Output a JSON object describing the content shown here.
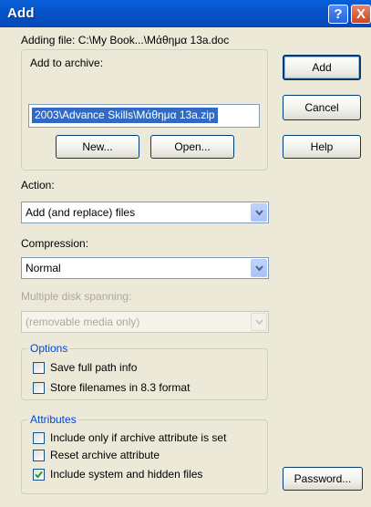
{
  "window": {
    "title": "Add",
    "help_glyph": "?",
    "close_glyph": "X"
  },
  "adding_file": "Adding file: C:\\My Book...\\Μάθημα 13a.doc",
  "add_to_archive": {
    "label": "Add to archive:",
    "value": "2003\\Advance Skills\\Μάθημα 13a.zip",
    "new_label": "New...",
    "open_label": "Open..."
  },
  "buttons": {
    "add": "Add",
    "cancel": "Cancel",
    "help": "Help",
    "password": "Password..."
  },
  "action": {
    "label": "Action:",
    "value": "Add (and replace) files"
  },
  "compression": {
    "label": "Compression:",
    "value": "Normal"
  },
  "spanning": {
    "label": "Multiple disk spanning:",
    "value": "(removable media only)"
  },
  "options": {
    "caption": "Options",
    "items": [
      {
        "label": "Save full path info",
        "checked": false
      },
      {
        "label": "Store filenames in 8.3 format",
        "checked": false
      }
    ]
  },
  "attributes": {
    "caption": "Attributes",
    "items": [
      {
        "label": "Include only if archive attribute is set",
        "checked": false
      },
      {
        "label": "Reset archive attribute",
        "checked": false
      },
      {
        "label": "Include system and hidden files",
        "checked": true
      }
    ]
  },
  "colors": {
    "titlebar": "#0553c9",
    "dialog_bg": "#ece9d8",
    "selection": "#316ac5",
    "group_caption": "#0046d5",
    "check_mark": "#21a121"
  }
}
